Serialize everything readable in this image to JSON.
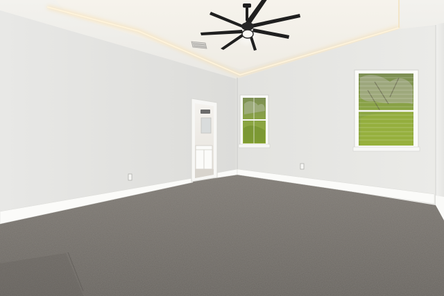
{
  "scene": {
    "subject": "empty-bedroom-interior",
    "elements": [
      "tray-ceiling-with-led-cove-lighting",
      "ceiling-fan-with-light",
      "hvac-vent",
      "doorway-to-bathroom",
      "window-left",
      "window-right",
      "gray-carpet-floor",
      "baseboards",
      "electrical-outlets"
    ],
    "colors": {
      "wall_light": "#ecebe8",
      "wall_shade": "#d9d9d6",
      "ceiling": "#f1f0ec",
      "cove_glow": "#f7dcaa",
      "carpet": "#77726d",
      "carpet_dark": "#5c5955",
      "trim": "#fbfbf9",
      "fan": "#1f1f1f",
      "foliage": "#7f9a3b"
    }
  }
}
